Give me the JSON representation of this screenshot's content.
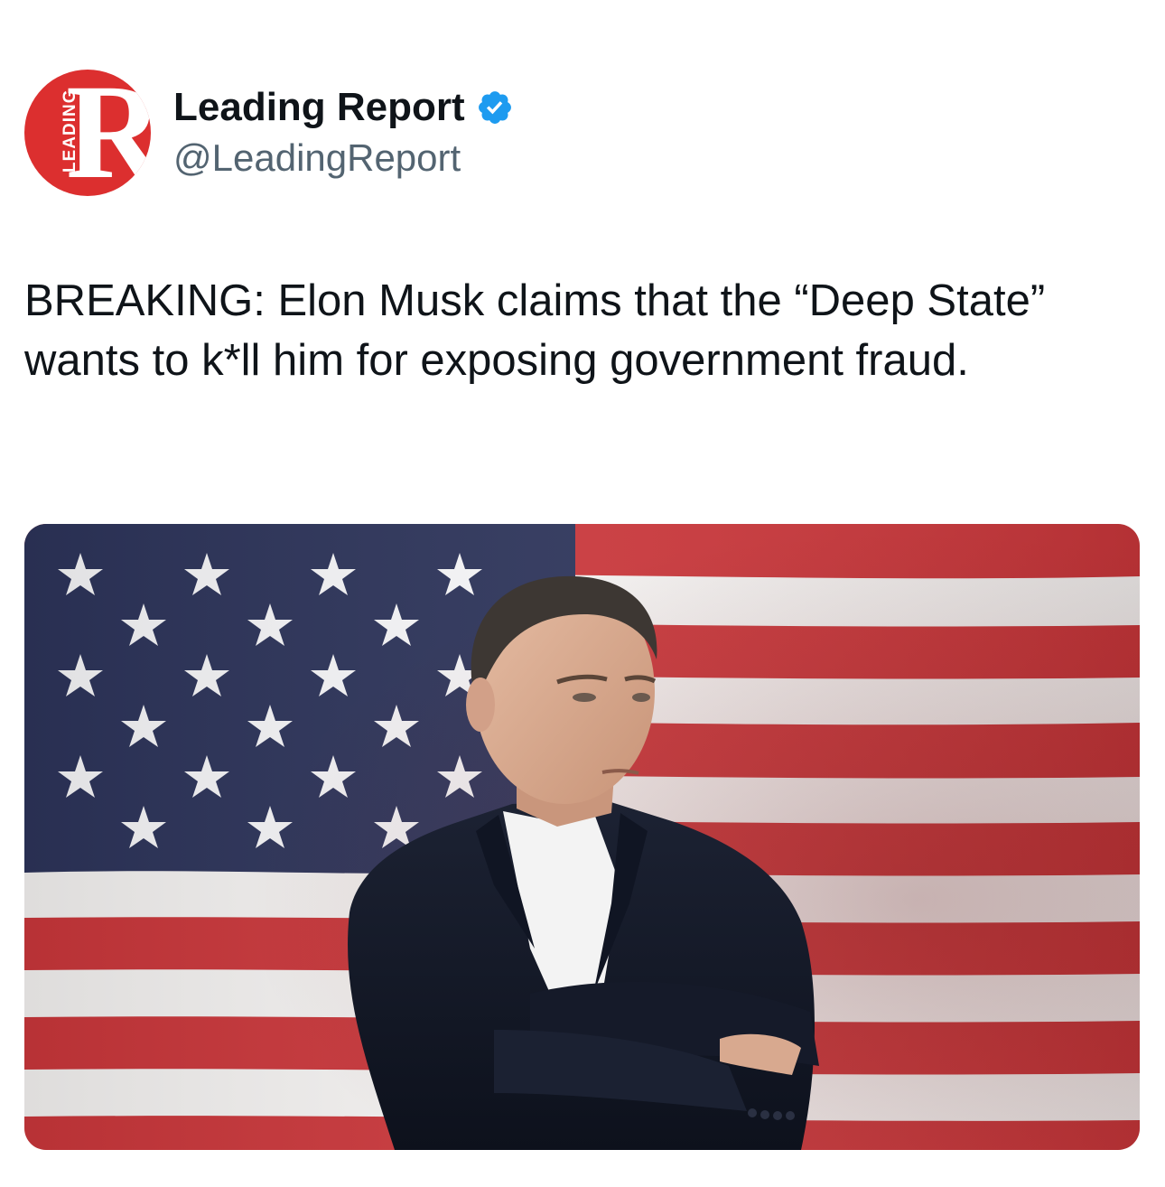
{
  "author": {
    "display_name": "Leading Report",
    "handle": "@LeadingReport",
    "verified": true,
    "avatar": {
      "letter": "R",
      "side_text": "LEADING",
      "color": "#dc2f2f"
    }
  },
  "tweet": {
    "text": "BREAKING: Elon Musk claims that the “Deep State” wants to k*ll him for exposing government fraud."
  },
  "icons": {
    "verified": "verified-check-icon"
  },
  "colors": {
    "verified_blue": "#1d9bf0",
    "flag_red": "#c8363a",
    "flag_white": "#f2f0ef",
    "flag_blue": "#2c3359"
  }
}
